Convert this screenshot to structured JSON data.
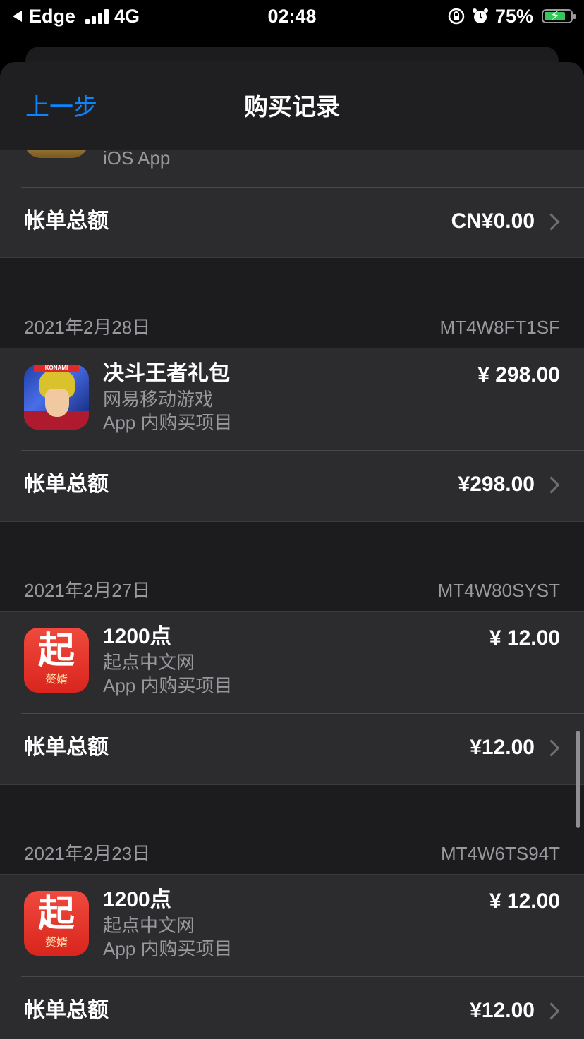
{
  "status_bar": {
    "carrier": "Edge",
    "network": "4G",
    "time": "02:48",
    "battery": "75%",
    "colors": {
      "battery_fill": "#35c759"
    }
  },
  "nav": {
    "back_label": "上一步",
    "title": "购买记录",
    "accent": "#0a84ff"
  },
  "top_card": {
    "subtitle": "iOS App",
    "total_label": "帐单总额",
    "total_amount": "CN¥0.00"
  },
  "orders": [
    {
      "date": "2021年2月28日",
      "order_id": "MT4W8FT1SF",
      "icon": "yugioh-duel-links-icon",
      "item_name": "决斗王者礼包",
      "developer": "网易移动游戏",
      "type": "App 内购买项目",
      "price": "¥ 298.00",
      "total_label": "帐单总额",
      "total_amount": "¥298.00"
    },
    {
      "date": "2021年2月27日",
      "order_id": "MT4W80SYST",
      "icon": "qidian-app-icon",
      "icon_text_main": "起",
      "icon_text_sub": "赘婿",
      "item_name": "1200点",
      "developer": "起点中文网",
      "type": "App 内购买项目",
      "price": "¥ 12.00",
      "total_label": "帐单总额",
      "total_amount": "¥12.00"
    },
    {
      "date": "2021年2月23日",
      "order_id": "MT4W6TS94T",
      "icon": "qidian-app-icon",
      "icon_text_main": "起",
      "icon_text_sub": "赘婿",
      "item_name": "1200点",
      "developer": "起点中文网",
      "type": "App 内购买项目",
      "price": "¥ 12.00",
      "total_label": "帐单总额",
      "total_amount": "¥12.00"
    }
  ]
}
